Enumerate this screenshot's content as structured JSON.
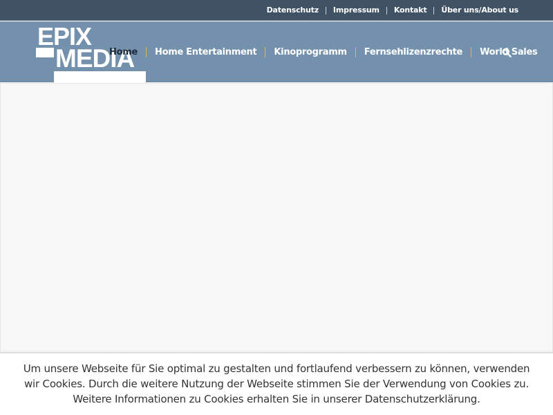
{
  "topbar": {
    "links": [
      "Datenschutz",
      "Impressum",
      "Kontakt",
      "Über uns/About us"
    ]
  },
  "logo": {
    "line1": "EPIX",
    "line2": "MEDIA"
  },
  "nav": {
    "items": [
      "Home",
      "Home Entertainment",
      "Kinoprogramm",
      "Fernsehlizenzrechte",
      "World Sales"
    ],
    "active": "Home",
    "search_icon": "search-icon"
  },
  "cookie": {
    "text": "Um unsere Webseite für Sie optimal zu gestalten und fortlaufend verbessern zu können, verwenden wir Cookies. Durch die weitere Nutzung der Webseite stimmen Sie der Verwendung von Cookies zu. Weitere Informationen zu Cookies erhalten Sie in unserer Datenschutzerklärung."
  },
  "colors": {
    "topbar": "#3f5364",
    "header": "#7391ac",
    "nav_separator": "#e6b24a",
    "content_bg": "#f8f8f8"
  }
}
